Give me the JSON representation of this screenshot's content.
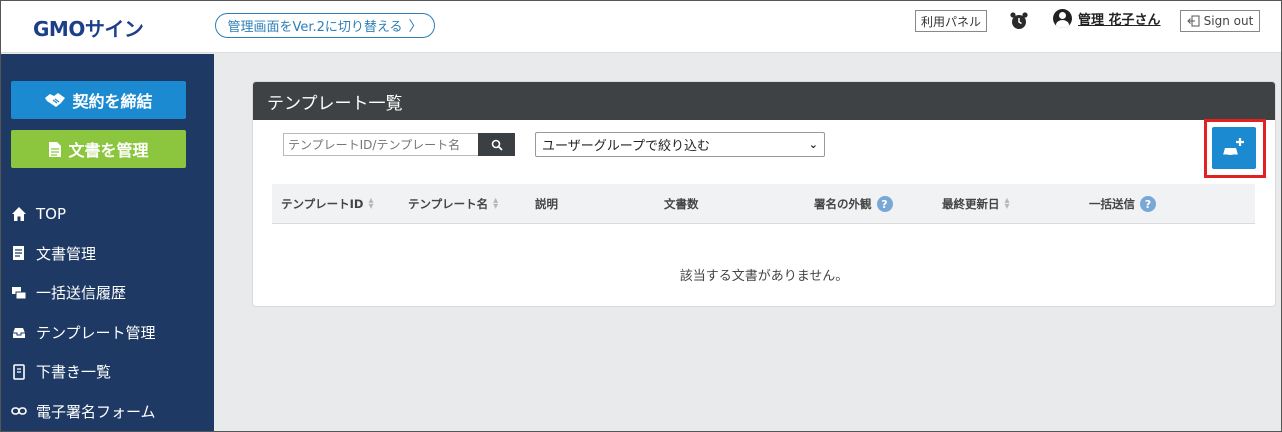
{
  "header": {
    "logo": "GMOサイン",
    "switch_label": "管理画面をVer.2に切り替える",
    "switch_chevron": "〉",
    "panel_label": "利用パネル",
    "user_name": "管理 花子さん",
    "signout_label": "Sign out"
  },
  "sidebar": {
    "contract_button": "契約を締結",
    "document_button": "文書を管理",
    "items": [
      {
        "label": "TOP",
        "icon": "home-icon"
      },
      {
        "label": "文書管理",
        "icon": "document-icon"
      },
      {
        "label": "一括送信履歴",
        "icon": "bulk-send-icon"
      },
      {
        "label": "テンプレート管理",
        "icon": "template-icon"
      },
      {
        "label": "下書き一覧",
        "icon": "draft-icon"
      },
      {
        "label": "電子署名フォーム",
        "icon": "link-icon"
      }
    ]
  },
  "main": {
    "title": "テンプレート一覧",
    "search_placeholder": "テンプレートID/テンプレート名",
    "group_filter": "ユーザーグループで絞り込む",
    "columns": [
      {
        "label": "テンプレートID",
        "sortable": true
      },
      {
        "label": "テンプレート名",
        "sortable": true
      },
      {
        "label": "説明"
      },
      {
        "label": "文書数"
      },
      {
        "label": "署名の外観",
        "help": "?"
      },
      {
        "label": "最終更新日",
        "sortable": true
      },
      {
        "label": "一括送信",
        "help": "?"
      }
    ],
    "empty_message": "該当する文書がありません。"
  },
  "colors": {
    "brand_blue": "#1b8ad1",
    "brand_green": "#8cc63e",
    "sidebar": "#1e3a64",
    "highlight": "#e02222"
  }
}
